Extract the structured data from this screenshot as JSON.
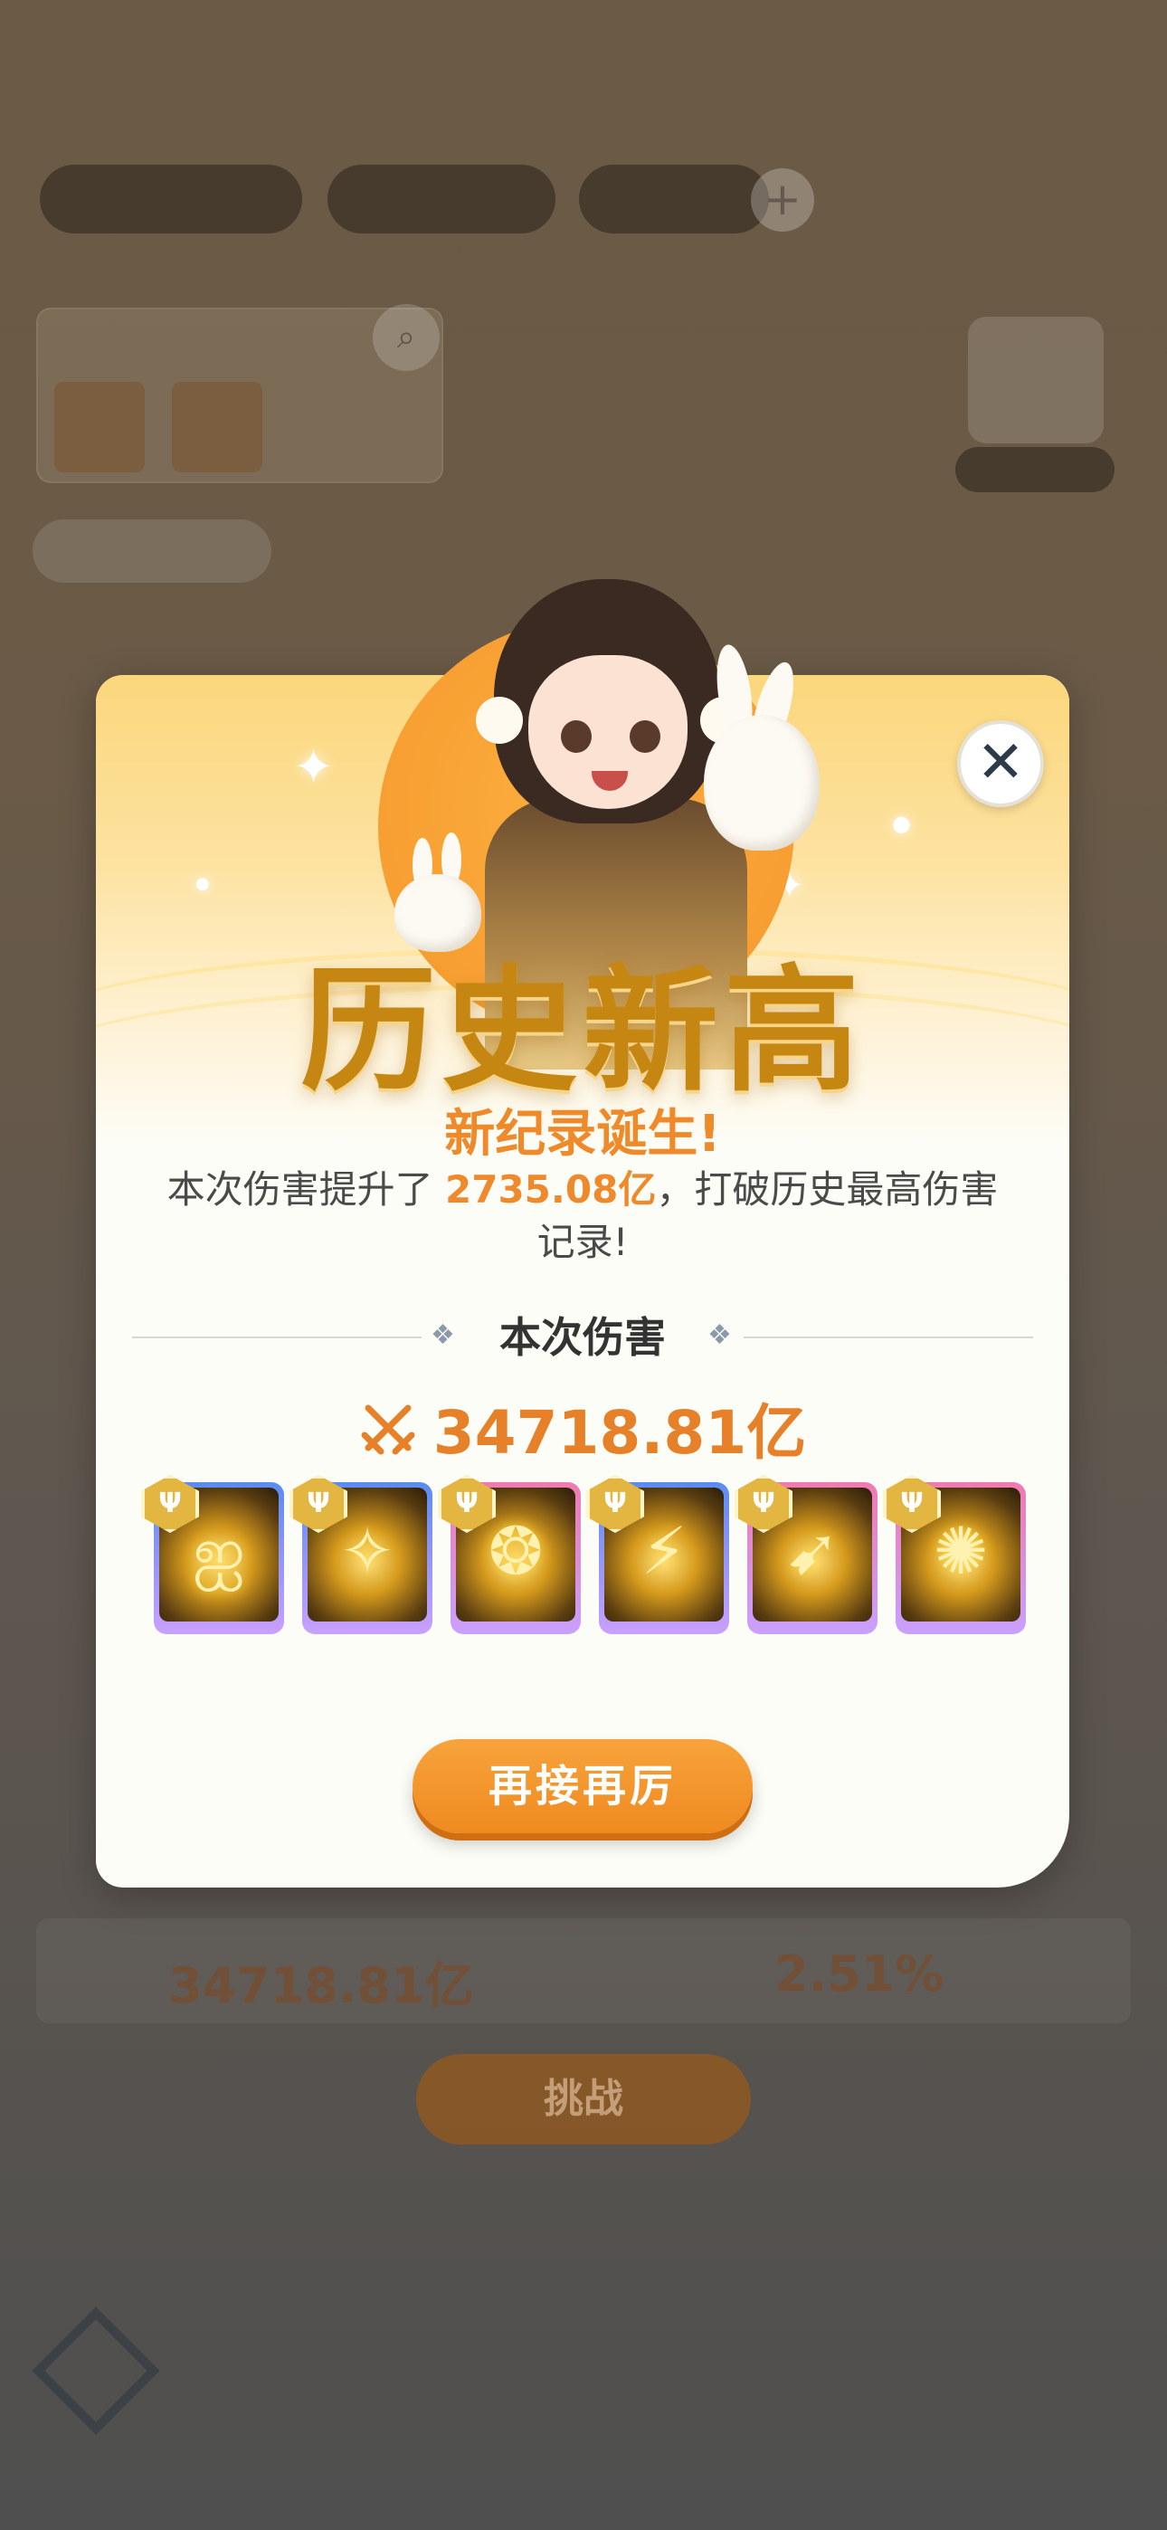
{
  "background": {
    "resource_pills": [
      "",
      "",
      ""
    ],
    "panel_title": "",
    "tag_label": "",
    "castle_label": "",
    "stats": {
      "damage": "34718.81亿",
      "ratio": "2.51%"
    },
    "challenge_label": "挑战"
  },
  "modal": {
    "title": "历史新高",
    "subtitle": "新纪录诞生!",
    "desc_prefix": "本次伤害提升了 ",
    "desc_value": "2735.08亿",
    "desc_suffix": "，打破历史最高伤害记录!",
    "section_title": "本次伤害",
    "damage_value": "34718.81亿",
    "skills": [
      {
        "name": "skill-1",
        "frame": "blue"
      },
      {
        "name": "skill-2",
        "frame": "blue"
      },
      {
        "name": "skill-3",
        "frame": "pink"
      },
      {
        "name": "skill-4",
        "frame": "blue"
      },
      {
        "name": "skill-5",
        "frame": "pink"
      },
      {
        "name": "skill-6",
        "frame": "pink"
      }
    ],
    "again_label": "再接再厉",
    "close_icon": "close-icon"
  },
  "colors": {
    "accent_orange": "#ef8a2c",
    "title_gold": "#c68712",
    "frame_blue": "#5a8cf0",
    "frame_pink": "#f07ab0"
  }
}
